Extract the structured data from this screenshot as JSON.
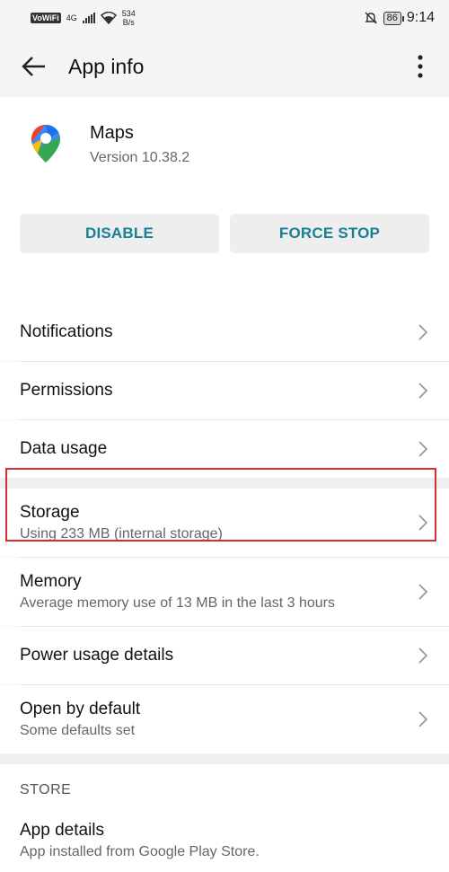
{
  "status_bar": {
    "vowifi": "VoWiFi",
    "network": "4G",
    "speed_value": "534",
    "speed_unit": "B/s",
    "battery": "86",
    "time": "9:14"
  },
  "app_bar": {
    "title": "App info"
  },
  "app": {
    "name": "Maps",
    "version": "Version 10.38.2"
  },
  "buttons": {
    "disable": "DISABLE",
    "force_stop": "FORCE STOP"
  },
  "items": [
    {
      "label": "Notifications"
    },
    {
      "label": "Permissions"
    },
    {
      "label": "Data usage"
    },
    {
      "label": "Storage",
      "sub": "Using 233 MB (internal storage)"
    },
    {
      "label": "Memory",
      "sub": "Average memory use of 13 MB in the last 3 hours"
    },
    {
      "label": "Power usage details"
    },
    {
      "label": "Open by default",
      "sub": "Some defaults set"
    }
  ],
  "store": {
    "section_title": "STORE",
    "item_label": "App details",
    "item_sub": "App installed from Google Play Store."
  },
  "colors": {
    "accent": "#1a7f95",
    "highlight": "#d32f2f"
  }
}
